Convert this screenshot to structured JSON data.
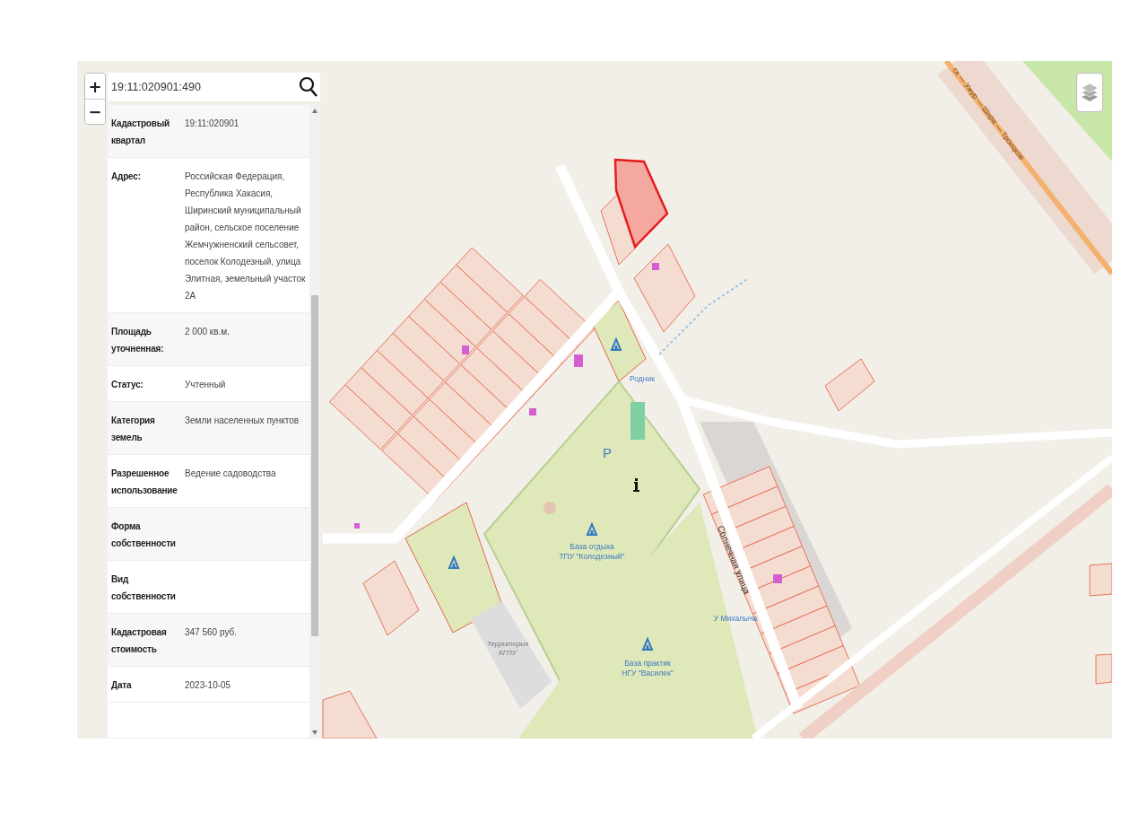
{
  "search": {
    "value": "19:11:020901:490"
  },
  "zoom_controls": [
    "+",
    "−"
  ],
  "details": [
    {
      "label": "Кадастровый квартал",
      "value": "19:11:020901"
    },
    {
      "label": "Адрес:",
      "value": "Российская Федерация, Республика Хакасия, Ширинский муниципальный район, сельское поселение Жемчужненский сельсовет, поселок Колодезный, улица Элитная, земельный участок 2А"
    },
    {
      "label": "Площадь уточненная:",
      "value": "2 000 кв.м."
    },
    {
      "label": "Статус:",
      "value": "Учтенный"
    },
    {
      "label": "Категория земель",
      "value": "Земли населенных пунктов"
    },
    {
      "label": "Разрешенное использование",
      "value": "Ведение садоводства"
    },
    {
      "label": "Форма собственности"
    },
    {
      "label": "Вид собственности"
    },
    {
      "label": "Кадастровая стоимость",
      "value": "347 560 руб."
    },
    {
      "label": "Дата",
      "value": "2023-10-05"
    }
  ],
  "map": {
    "road_label": "ск — Ужур — Шира — Троицкое",
    "labels": [
      {
        "kind": "poi",
        "lines": [
          "Родник"
        ]
      },
      {
        "kind": "parking",
        "lines": [
          "P"
        ]
      },
      {
        "kind": "place",
        "lines": [
          "База отдыха",
          "ТПУ \"Колодезный\""
        ]
      },
      {
        "kind": "area",
        "lines": [
          "Территория",
          "КГПУ"
        ]
      },
      {
        "kind": "street",
        "lines": [
          "Солнечная улица"
        ]
      },
      {
        "kind": "place",
        "lines": [
          "У Михалыча"
        ]
      },
      {
        "kind": "place",
        "lines": [
          "База практик",
          "НГУ \"Василек\""
        ]
      }
    ]
  }
}
